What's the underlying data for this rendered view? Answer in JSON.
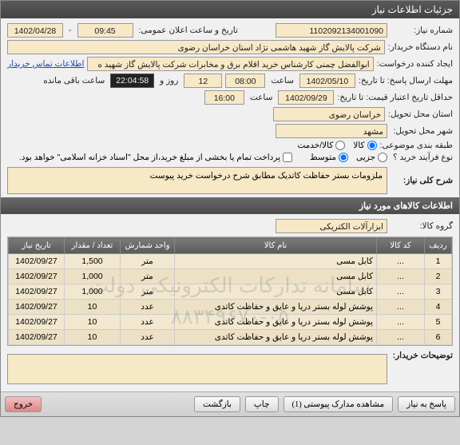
{
  "window": {
    "title": "جزئیات اطلاعات نیاز"
  },
  "fields": {
    "need_no_label": "شماره نیاز:",
    "need_no": "1102092134001090",
    "announce_label": "تاریخ و ساعت اعلان عمومی:",
    "announce_date": "1402/04/28",
    "announce_time": "09:45",
    "buyer_label": "نام دستگاه خریدار:",
    "buyer": "شرکت پالایش گاز شهید هاشمی نژاد   استان خراسان رضوی",
    "requester_label": "ایجاد کننده درخواست:",
    "requester": "ابوالفضل چمنی کارشناس خرید اقلام برق و مخابرات شرکت پالایش گاز شهید ه",
    "contact_link": "اطلاعات تماس خریدار",
    "deadline_label": "مهلت ارسال پاسخ: تا تاریخ:",
    "deadline_date": "1402/05/10",
    "deadline_time_label": "ساعت",
    "deadline_time": "08:00",
    "remain_days": "12",
    "remain_days_label": "روز و",
    "remain_time": "22:04:58",
    "remain_suffix": "ساعت باقی مانده",
    "validity_label": "حداقل تاریخ اعتبار قیمت: تا تاریخ:",
    "validity_date": "1402/09/29",
    "validity_time_label": "ساعت",
    "validity_time": "16:00",
    "province_label": "استان محل تحویل:",
    "province": "خراسان رضوی",
    "city_label": "شهر محل تحویل:",
    "city": "مشهد",
    "topic_class_label": "طبقه بندی موضوعی:",
    "topic_goods": "کالا",
    "topic_service": "کالا/خدمت",
    "nature_label": "نوع فرآیند خرید ؟",
    "nature_partial": "جزیی",
    "nature_medium": "متوسط",
    "payment_note": "پرداخت تمام یا بخشی از مبلغ خرید،از محل \"اسناد خزانه اسلامی\" خواهد بود.",
    "desc_label": "شرح کلی نیاز:",
    "desc": "ملزومات بستر حفاظت کاتدیک مطابق شرح درخواست خرید پیوست"
  },
  "items_section": {
    "title": "اطلاعات کالاهای مورد نیاز",
    "group_label": "گروه کالا:",
    "group": "ابزارآلات الکتریکی"
  },
  "table": {
    "headers": [
      "ردیف",
      "کد کالا",
      "نام کالا",
      "واحد شمارش",
      "تعداد / مقدار",
      "تاریخ نیاز"
    ],
    "rows": [
      {
        "n": "1",
        "code": "...",
        "name": "کابل مسی",
        "unit": "متر",
        "qty": "1,500",
        "date": "1402/09/27"
      },
      {
        "n": "2",
        "code": "...",
        "name": "کابل مسی",
        "unit": "متر",
        "qty": "1,000",
        "date": "1402/09/27"
      },
      {
        "n": "3",
        "code": "...",
        "name": "کابل مسی",
        "unit": "متر",
        "qty": "1,000",
        "date": "1402/09/27"
      },
      {
        "n": "4",
        "code": "...",
        "name": "پوشش لوله بستر دریا و عایق و حفاظت کاتدی",
        "unit": "عدد",
        "qty": "10",
        "date": "1402/09/27"
      },
      {
        "n": "5",
        "code": "...",
        "name": "پوشش لوله بستر دریا و عایق و حفاظت کاتدی",
        "unit": "عدد",
        "qty": "10",
        "date": "1402/09/27"
      },
      {
        "n": "6",
        "code": "...",
        "name": "پوشش لوله بستر دریا و عایق و حفاظت کاتدی",
        "unit": "عدد",
        "qty": "10",
        "date": "1402/09/27"
      }
    ]
  },
  "watermark": {
    "line1": "سامانه تدارکات الکترونیکی دولت",
    "line2": "۸۸۳۴۹۶۷۰-۰۵"
  },
  "buyer_notes_label": "توضیحات خریدار:",
  "footer": {
    "reply": "پاسخ به نیاز",
    "attach": "مشاهده مدارک پیوستی  (1)",
    "print": "چاپ",
    "back": "بازگشت",
    "exit": "خروج"
  }
}
